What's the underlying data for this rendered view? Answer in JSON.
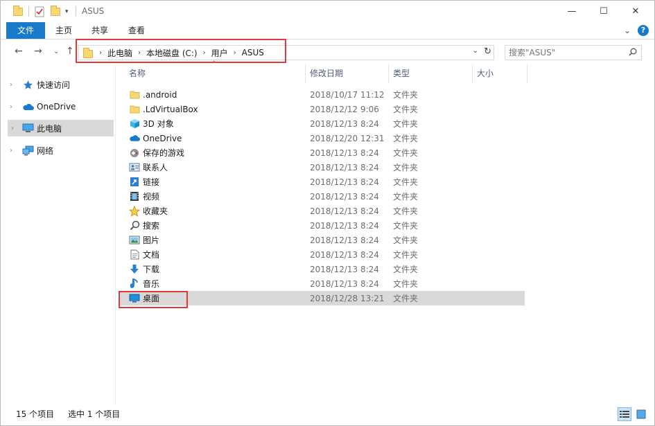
{
  "window": {
    "title": "ASUS",
    "minimize_glyph": "—",
    "maximize_glyph": "☐",
    "close_glyph": "✕"
  },
  "ribbon": {
    "tabs": [
      "文件",
      "主页",
      "共享",
      "查看"
    ],
    "expand_glyph": "⌄",
    "help_glyph": "?"
  },
  "nav": {
    "back_glyph": "←",
    "forward_glyph": "→",
    "recent_glyph": "⌄",
    "up_glyph": "↑"
  },
  "address": {
    "segments": [
      "此电脑",
      "本地磁盘 (C:)",
      "用户",
      "ASUS"
    ],
    "separator": "›",
    "dropdown_glyph": "⌄",
    "refresh_glyph": "↻"
  },
  "search": {
    "placeholder": "搜索\"ASUS\""
  },
  "navpane": {
    "items": [
      {
        "label": "快速访问",
        "icon": "star-icon"
      },
      {
        "label": "OneDrive",
        "icon": "cloud-icon"
      },
      {
        "label": "此电脑",
        "icon": "computer-icon"
      },
      {
        "label": "网络",
        "icon": "network-icon"
      }
    ],
    "chevron_glyph": "›"
  },
  "columns": {
    "name": "名称",
    "date": "修改日期",
    "type": "类型",
    "size": "大小",
    "sort_glyph": "⌃"
  },
  "files": [
    {
      "name": ".android",
      "date": "2018/10/17 11:12",
      "type": "文件夹",
      "icon": "folder-icon"
    },
    {
      "name": ".LdVirtualBox",
      "date": "2018/12/12 9:06",
      "type": "文件夹",
      "icon": "folder-icon"
    },
    {
      "name": "3D 对象",
      "date": "2018/12/13 8:24",
      "type": "文件夹",
      "icon": "cube-icon"
    },
    {
      "name": "OneDrive",
      "date": "2018/12/20 12:31",
      "type": "文件夹",
      "icon": "cloud-icon"
    },
    {
      "name": "保存的游戏",
      "date": "2018/12/13 8:24",
      "type": "文件夹",
      "icon": "gamepad-icon"
    },
    {
      "name": "联系人",
      "date": "2018/12/13 8:24",
      "type": "文件夹",
      "icon": "contacts-icon"
    },
    {
      "name": "链接",
      "date": "2018/12/13 8:24",
      "type": "文件夹",
      "icon": "link-icon"
    },
    {
      "name": "视频",
      "date": "2018/12/13 8:24",
      "type": "文件夹",
      "icon": "video-icon"
    },
    {
      "name": "收藏夹",
      "date": "2018/12/13 8:24",
      "type": "文件夹",
      "icon": "star-icon"
    },
    {
      "name": "搜索",
      "date": "2018/12/13 8:24",
      "type": "文件夹",
      "icon": "search-icon"
    },
    {
      "name": "图片",
      "date": "2018/12/13 8:24",
      "type": "文件夹",
      "icon": "picture-icon"
    },
    {
      "name": "文档",
      "date": "2018/12/13 8:24",
      "type": "文件夹",
      "icon": "document-icon"
    },
    {
      "name": "下载",
      "date": "2018/12/13 8:24",
      "type": "文件夹",
      "icon": "download-icon"
    },
    {
      "name": "音乐",
      "date": "2018/12/13 8:24",
      "type": "文件夹",
      "icon": "music-icon"
    },
    {
      "name": "桌面",
      "date": "2018/12/28 13:21",
      "type": "文件夹",
      "icon": "desktop-icon"
    }
  ],
  "status": {
    "count": "15 个项目",
    "selected": "选中 1 个项目"
  },
  "colors": {
    "accent": "#1979ca",
    "selection": "#d9d9d9",
    "highlight": "#e23a3a"
  }
}
